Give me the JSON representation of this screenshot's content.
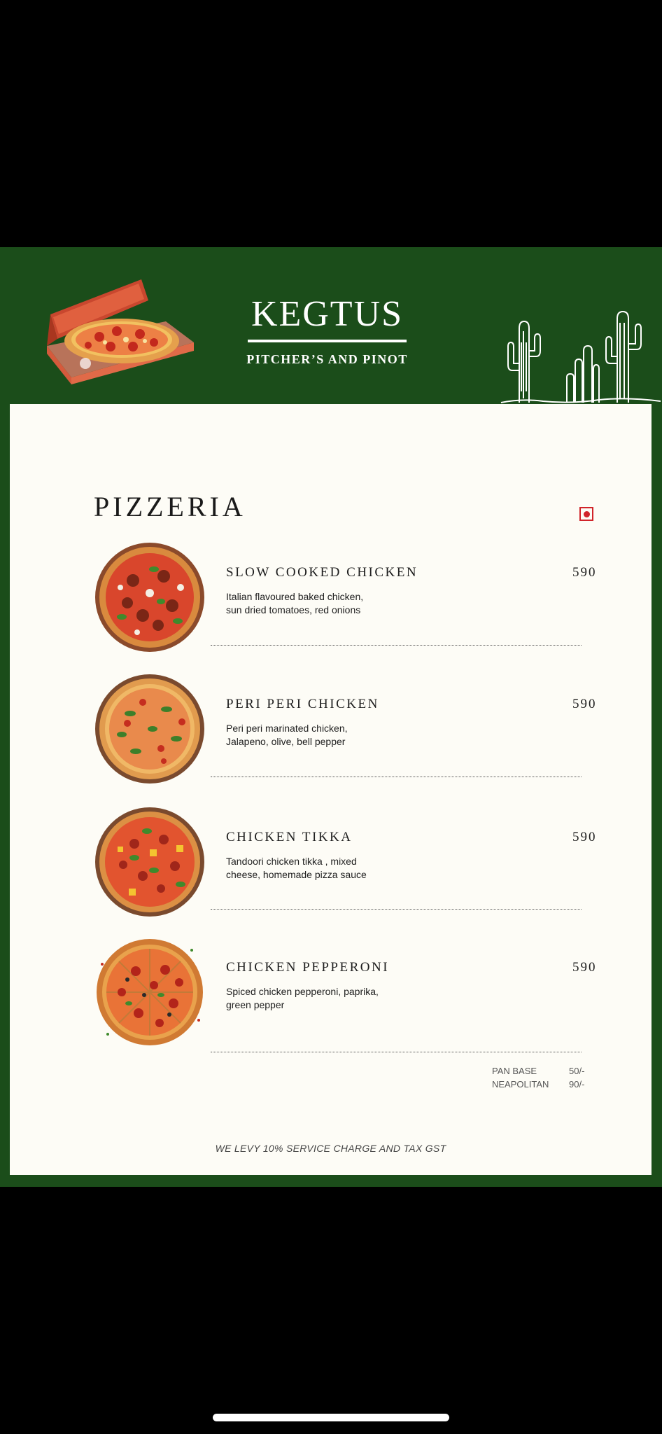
{
  "header": {
    "brand_name": "KEGTUS",
    "tagline": "PITCHER’S AND PINOT"
  },
  "section": {
    "title": "PIZZERIA"
  },
  "items": [
    {
      "name": "SLOW COOKED CHICKEN",
      "price": "590",
      "description_line1": "Italian flavoured baked chicken,",
      "description_line2": "sun dried tomatoes, red onions"
    },
    {
      "name": "PERI PERI CHICKEN",
      "price": "590",
      "description_line1": "Peri peri marinated chicken,",
      "description_line2": "Jalapeno, olive, bell pepper"
    },
    {
      "name": "CHICKEN TIKKA",
      "price": "590",
      "description_line1": "Tandoori chicken tikka , mixed",
      "description_line2": "cheese, homemade pizza sauce"
    },
    {
      "name": "CHICKEN PEPPERONI",
      "price": "590",
      "description_line1": "Spiced chicken pepperoni, paprika,",
      "description_line2": "green pepper"
    }
  ],
  "extras": [
    {
      "label": "PAN BASE",
      "price": "50/-"
    },
    {
      "label": "NEAPOLITAN",
      "price": "90/-"
    }
  ],
  "footer": {
    "note": "WE LEVY 10% SERVICE CHARGE AND TAX GST"
  },
  "colors": {
    "header_green": "#1b4d1a",
    "paper": "#fdfcf6",
    "non_veg_mark": "#d1242a"
  }
}
